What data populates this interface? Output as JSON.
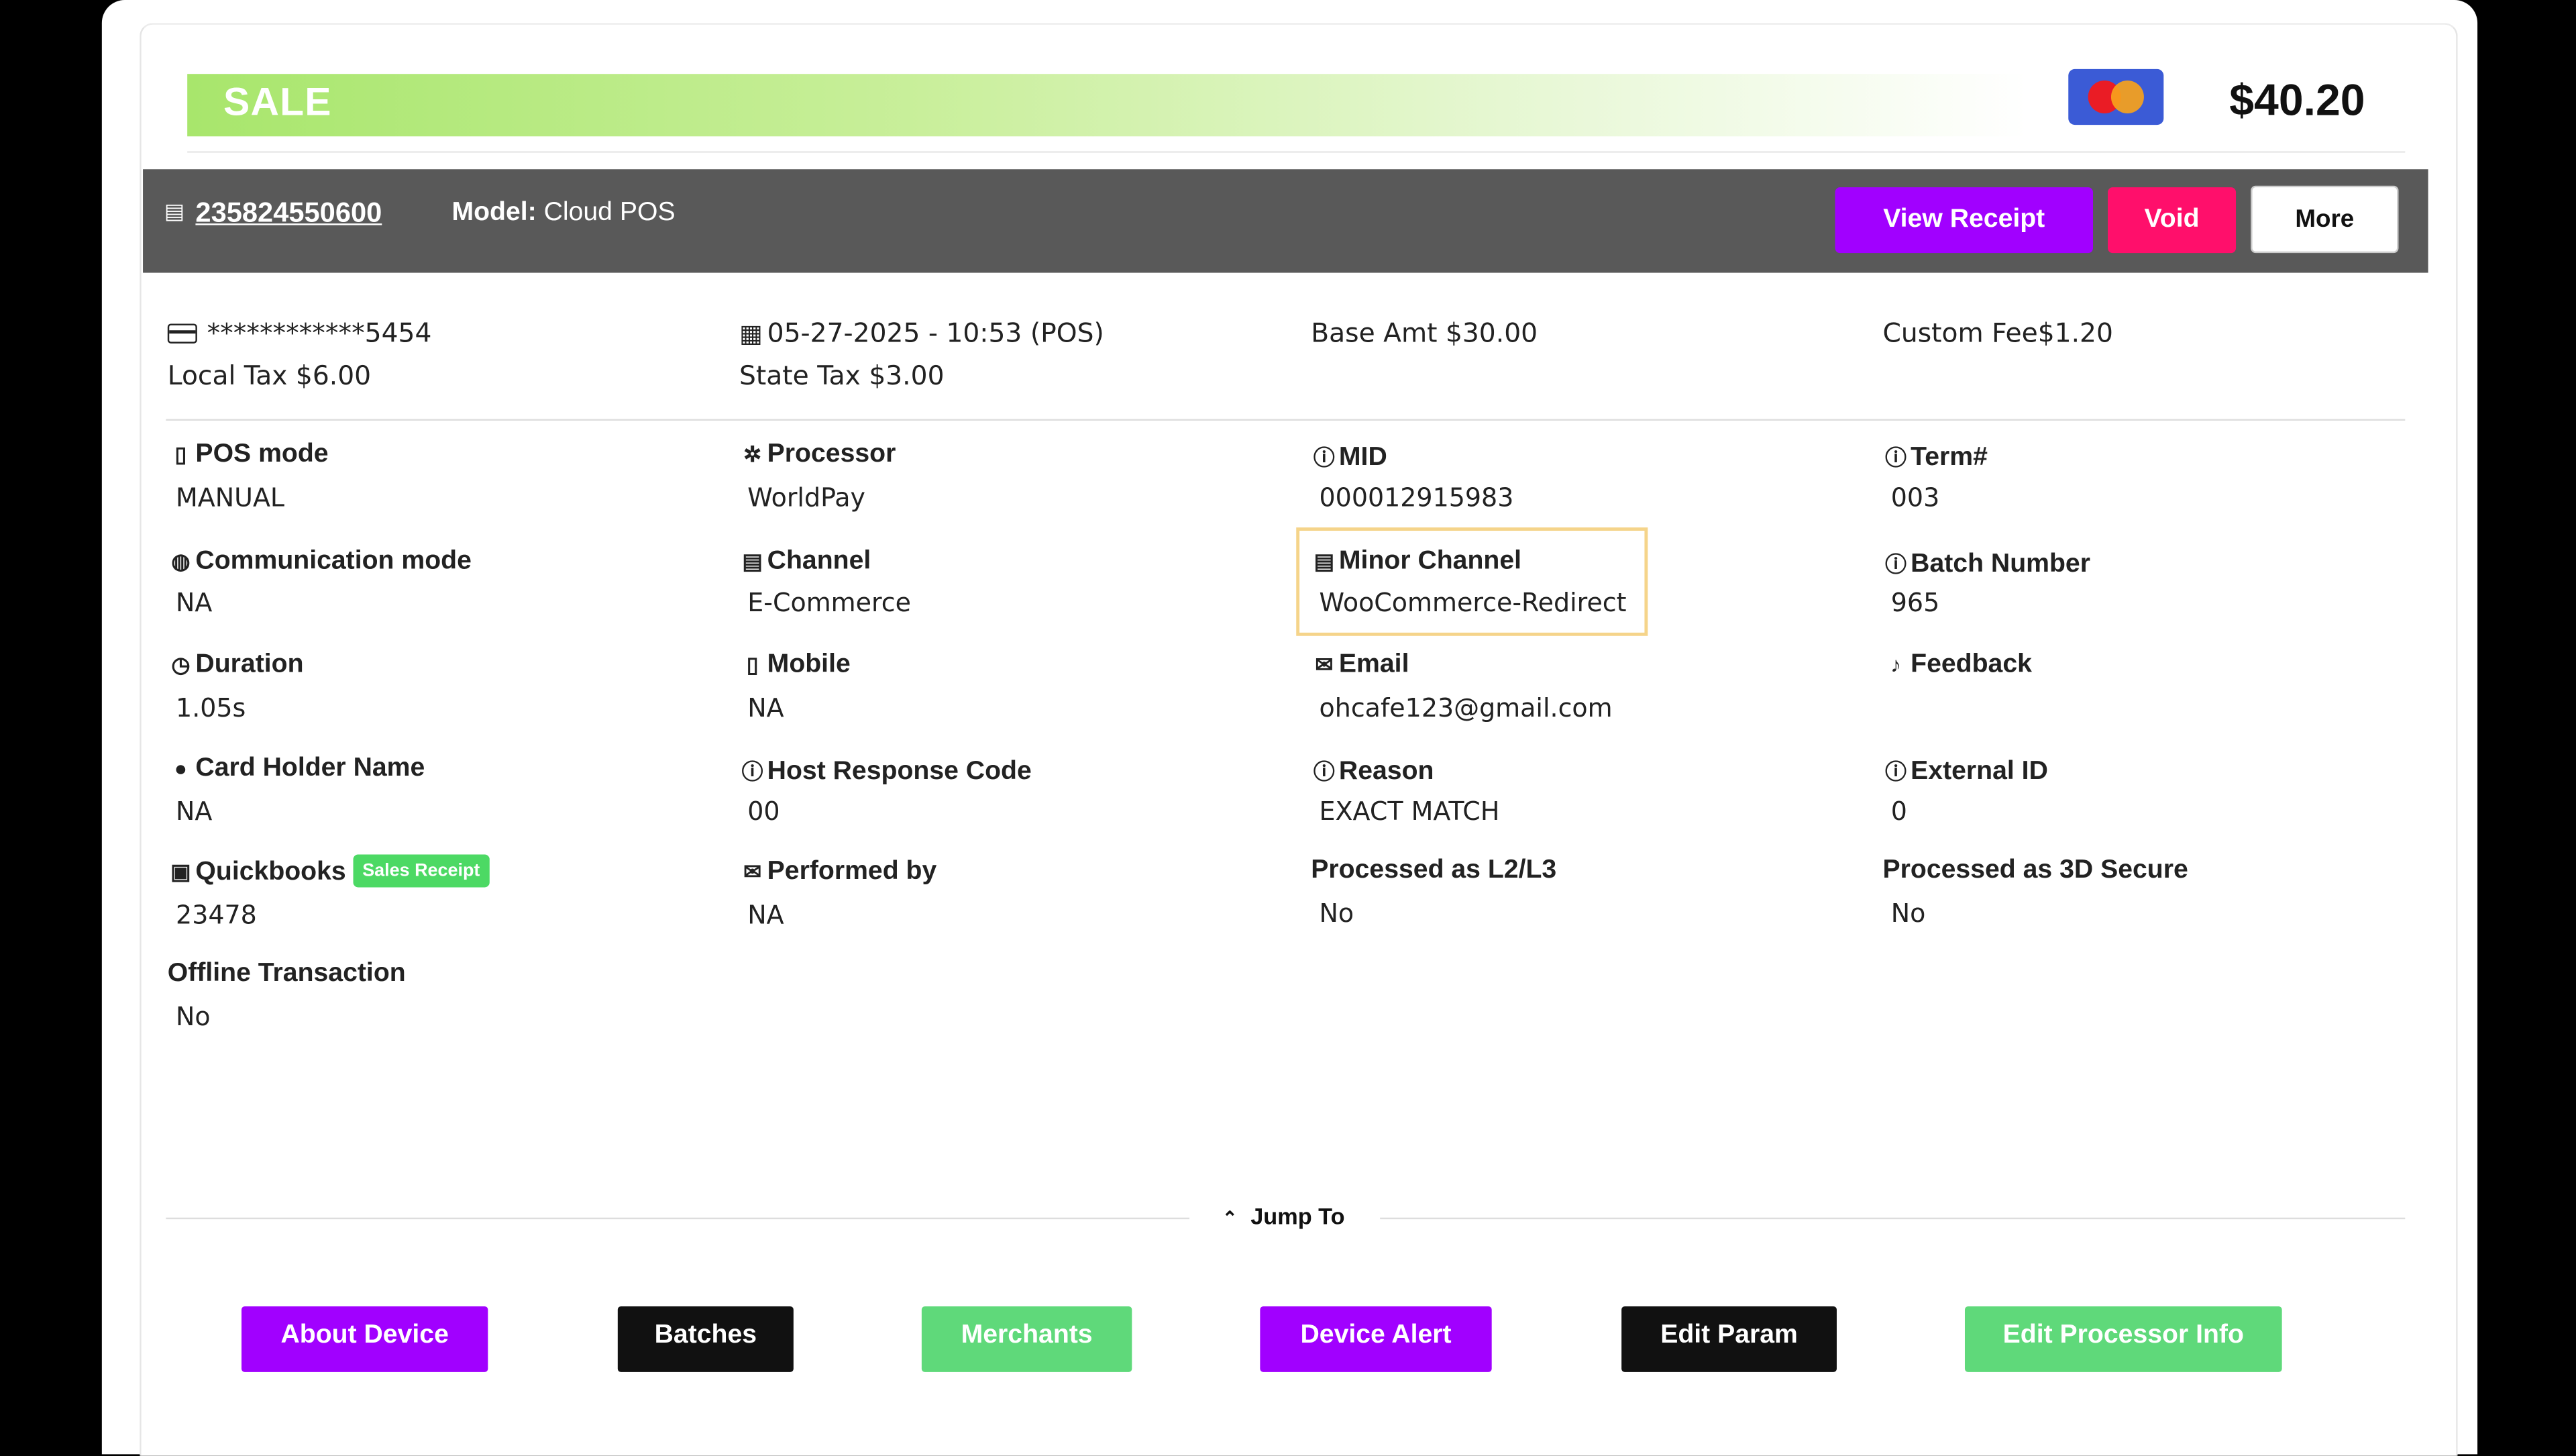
{
  "header": {
    "sale_label": "SALE",
    "amount": "$40.20",
    "card_brand_icon": "mastercard-logo"
  },
  "transaction_bar": {
    "id_icon": "device-icon",
    "transaction_id": "235824550600",
    "model_label": "Model:",
    "model_value": " Cloud POS",
    "buttons": {
      "view_receipt": "View Receipt",
      "void": "Void",
      "more": "More"
    }
  },
  "summary": {
    "card_icon": "credit-card-icon",
    "card_number": "************5454",
    "local_tax": "Local Tax $6.00",
    "date_icon": "calendar-icon",
    "datetime": "05-27-2025 - 10:53 (POS)",
    "state_tax": "State Tax $3.00",
    "base_amt": "Base Amt $30.00",
    "custom_fee": "Custom Fee$1.20"
  },
  "details": {
    "pos_mode": {
      "label": "POS mode",
      "value": "MANUAL",
      "icon": "mobile-icon"
    },
    "processor": {
      "label": "Processor",
      "value": "WorldPay",
      "icon": "gear-icon"
    },
    "mid": {
      "label": "MID",
      "value": "000012915983",
      "icon": "info-icon"
    },
    "term": {
      "label": "Term#",
      "value": "003",
      "icon": "info-icon"
    },
    "communication_mode": {
      "label": "Communication mode",
      "value": "NA",
      "icon": "globe-icon"
    },
    "channel": {
      "label": "Channel",
      "value": "E-Commerce",
      "icon": "device-icon"
    },
    "minor_channel": {
      "label": "Minor Channel",
      "value": "WooCommerce-Redirect",
      "icon": "device-icon"
    },
    "batch_number": {
      "label": "Batch Number",
      "value": "965",
      "icon": "info-icon"
    },
    "duration": {
      "label": "Duration",
      "value": "1.05s",
      "icon": "timer-icon"
    },
    "mobile": {
      "label": "Mobile",
      "value": "NA",
      "icon": "phone-icon"
    },
    "email": {
      "label": "Email",
      "value": "ohcafe123@gmail.com",
      "icon": "envelope-icon"
    },
    "feedback": {
      "label": "Feedback",
      "value": "",
      "icon": "feedback-icon"
    },
    "card_holder_name": {
      "label": "Card Holder Name",
      "value": "NA",
      "icon": "user-icon"
    },
    "host_response_code": {
      "label": "Host Response Code",
      "value": "00",
      "icon": "info-icon"
    },
    "reason": {
      "label": "Reason",
      "value": "EXACT MATCH",
      "icon": "info-icon"
    },
    "external_id": {
      "label": "External ID",
      "value": "0",
      "icon": "info-icon"
    },
    "quickbooks": {
      "label": "Quickbooks",
      "value": "23478",
      "badge": "Sales Receipt",
      "icon": "book-icon"
    },
    "performed_by": {
      "label": "Performed by",
      "value": "NA",
      "icon": "envelope-outline-icon"
    },
    "processed_l2l3": {
      "label": "Processed as L2/L3",
      "value": "No"
    },
    "processed_3ds": {
      "label": "Processed as 3D Secure",
      "value": "No"
    },
    "offline_transaction": {
      "label": "Offline Transaction",
      "value": "No"
    }
  },
  "jump_to": {
    "label": "Jump To",
    "icon": "double-chevron-up-icon",
    "buttons": [
      {
        "label": "About Device",
        "color": "#a100ff"
      },
      {
        "label": "Batches",
        "color": "#111111"
      },
      {
        "label": "Merchants",
        "color": "#5fd97a"
      },
      {
        "label": "Device Alert",
        "color": "#a100ff"
      },
      {
        "label": "Edit Param",
        "color": "#111111"
      },
      {
        "label": "Edit Processor Info",
        "color": "#5fd97a"
      }
    ]
  }
}
